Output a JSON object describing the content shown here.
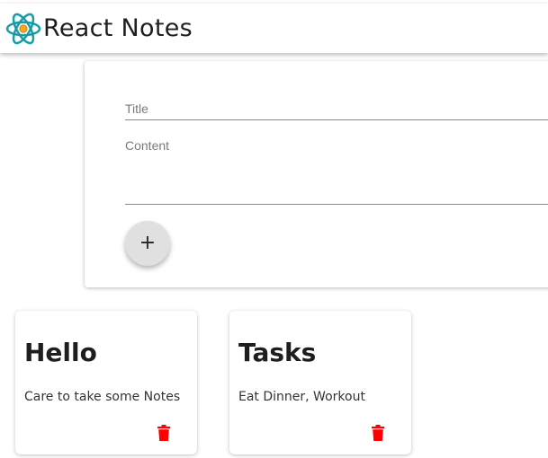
{
  "header": {
    "title": "React Notes",
    "logo_icon": "atom-icon"
  },
  "form": {
    "title_placeholder": "Title",
    "content_placeholder": "Content",
    "add_button_label": "+"
  },
  "notes": [
    {
      "title": "Hello",
      "content": "Care to take some Notes",
      "delete_icon": "trash-icon"
    },
    {
      "title": "Tasks",
      "content": "Eat Dinner, Workout",
      "delete_icon": "trash-icon"
    }
  ],
  "colors": {
    "delete": "#ff0000",
    "logo_accent": "#1aaeb4",
    "logo_core": "#f5a623",
    "fab": "#e0e0e0"
  }
}
